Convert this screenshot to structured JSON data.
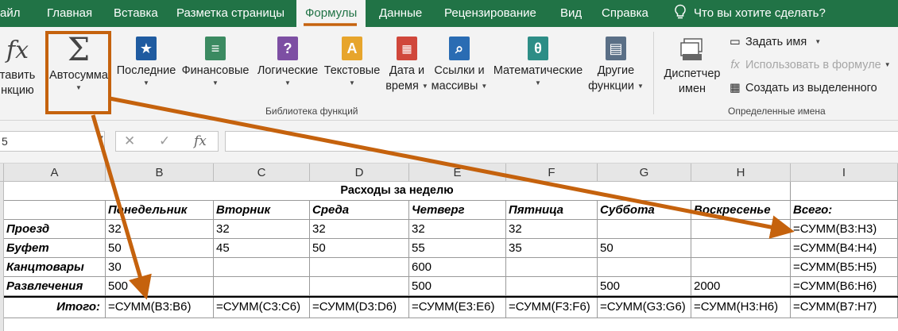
{
  "tabs": [
    "айл",
    "Главная",
    "Вставка",
    "Разметка страницы",
    "Формулы",
    "Данные",
    "Рецензирование",
    "Вид",
    "Справка"
  ],
  "active_tab": "Формулы",
  "tellme": "Что вы хотите сделать?",
  "ribbon": {
    "insert_fn": {
      "line1": "тавить",
      "line2": "нкцию"
    },
    "autosum": "Автосумма",
    "recent": "Последние",
    "financial": "Финансовые",
    "logical": "Логические",
    "text": "Текстовые",
    "datetime": {
      "line1": "Дата и",
      "line2": "время"
    },
    "lookup": {
      "line1": "Ссылки и",
      "line2": "массивы"
    },
    "math": "Математические",
    "more": {
      "line1": "Другие",
      "line2": "функции"
    },
    "library_label": "Библиотека функций",
    "name_manager": {
      "line1": "Диспетчер",
      "line2": "имен"
    },
    "define_name": "Задать имя",
    "use_in_formula": "Использовать в формуле",
    "create_from_selection": "Создать из выделенного",
    "defined_names_label": "Определенные имена",
    "icons": {
      "recent": "star-book-icon",
      "financial": "coins-book-icon",
      "logical": "question-book-icon",
      "text": "a-book-icon",
      "datetime": "calendar-book-icon",
      "lookup": "magnifier-book-icon",
      "math": "theta-book-icon",
      "more": "book-stack-icon"
    }
  },
  "formula_bar": {
    "name_box": "5",
    "fx": "fx"
  },
  "columns": [
    "A",
    "B",
    "C",
    "D",
    "E",
    "F",
    "G",
    "H",
    "I"
  ],
  "sheet": {
    "title": "Расходы за неделю",
    "headers": [
      "Понедельник",
      "Вторник",
      "Среда",
      "Четверг",
      "Пятница",
      "Суббота",
      "Воскресенье",
      "Всего:"
    ],
    "rows": [
      {
        "label": "Проезд",
        "values": [
          "32",
          "32",
          "32",
          "32",
          "32",
          "",
          "",
          "=СУММ(B3:H3)"
        ]
      },
      {
        "label": "Буфет",
        "values": [
          "50",
          "45",
          "50",
          "55",
          "35",
          "50",
          "",
          "=СУММ(B4:H4)"
        ]
      },
      {
        "label": "Канцтовары",
        "values": [
          "30",
          "",
          "",
          "600",
          "",
          "",
          "",
          "=СУММ(B5:H5)"
        ]
      },
      {
        "label": "Развлечения",
        "values": [
          "500",
          "",
          "",
          "500",
          "",
          "500",
          "2000",
          "=СУММ(B6:H6)"
        ]
      }
    ],
    "total": {
      "label": "Итого:",
      "values": [
        "=СУММ(B3:B6)",
        "=СУММ(C3:C6)",
        "=СУММ(D3:D6)",
        "=СУММ(E3:E6)",
        "=СУММ(F3:F6)",
        "=СУММ(G3:G6)",
        "=СУММ(H3:H6)",
        "=СУММ(B7:H7)"
      ]
    }
  },
  "colors": {
    "excel_green": "#217346",
    "annotation": "#c5620d",
    "ribbon_bg": "#f3f3f3"
  }
}
